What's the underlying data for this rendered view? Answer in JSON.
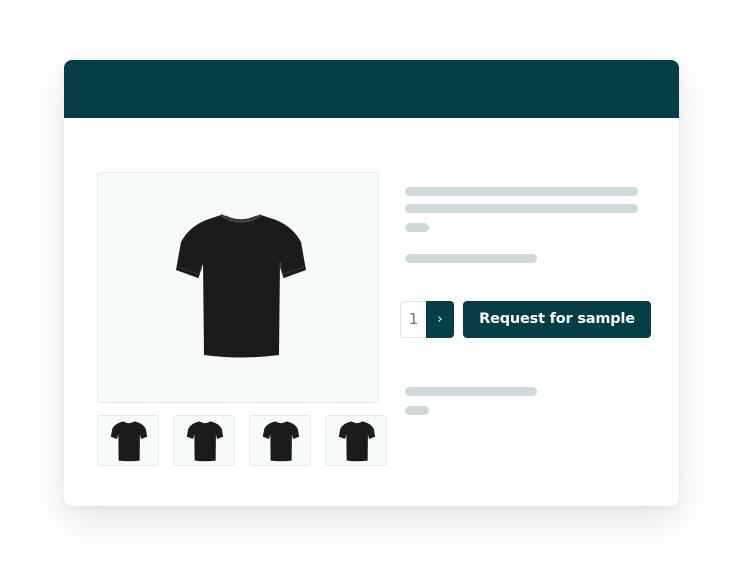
{
  "product": {
    "quantity": "1",
    "next_icon": "chevron-right-icon",
    "cta_label": "Request for sample",
    "gallery": {
      "main_image_icon": "black-tshirt-image",
      "thumbnail_icon": "black-tshirt-thumbnail",
      "thumbnail_count": 4
    }
  },
  "colors": {
    "header": "#063e45",
    "accent": "#063e45",
    "placeholder": "#cdd9db",
    "product": "#1b1b1b"
  }
}
